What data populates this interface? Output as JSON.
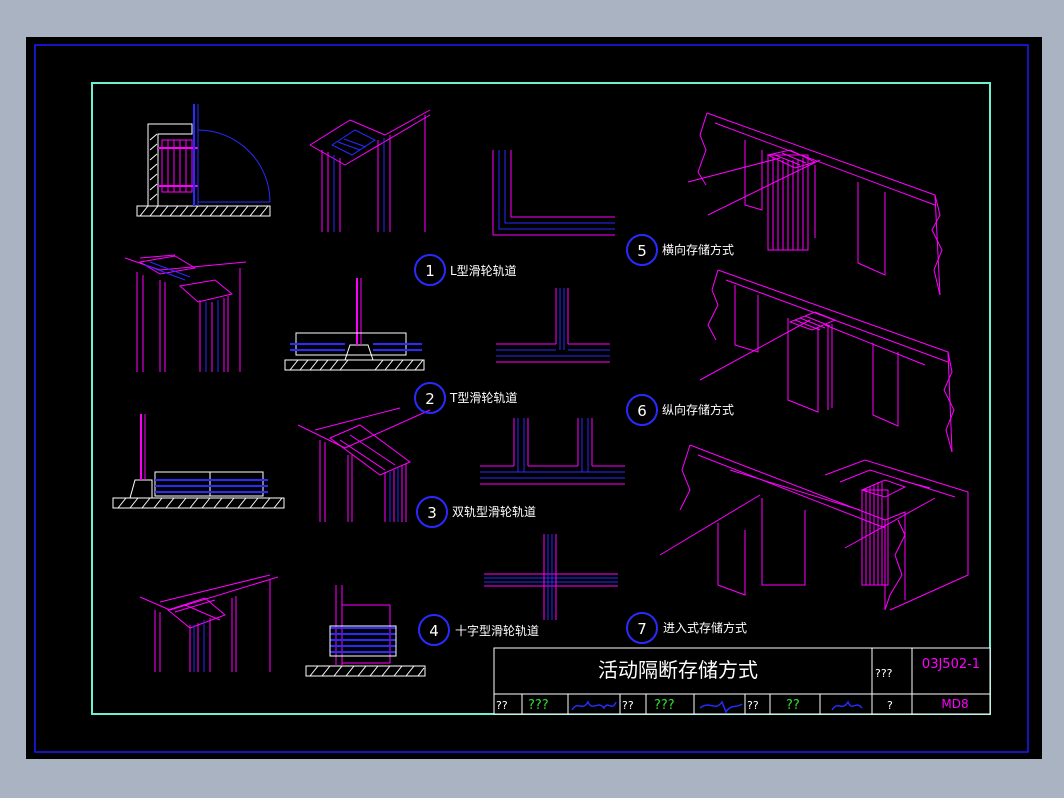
{
  "colors": {
    "background_gray": "#a9b3c1",
    "canvas": "#000000",
    "outer_frame": "#1a1aff",
    "inner_frame": "#6cf0d0",
    "magenta": "#ff00ff",
    "blue": "#2a2aff",
    "white": "#ffffff",
    "green": "#33dd33",
    "cyan": "#00ffff"
  },
  "callouts": [
    {
      "num": "1",
      "label": "L型滑轮轨道"
    },
    {
      "num": "2",
      "label": "T型滑轮轨道"
    },
    {
      "num": "3",
      "label": "双轨型滑轮轨道"
    },
    {
      "num": "4",
      "label": "十字型滑轮轨道"
    },
    {
      "num": "5",
      "label": "横向存储方式"
    },
    {
      "num": "6",
      "label": "纵向存储方式"
    },
    {
      "num": "7",
      "label": "进入式存储方式"
    }
  ],
  "title_block": {
    "title": "活动隔断存储方式",
    "code_label": "???",
    "atlas_number": "03J502-1",
    "page_label": "?",
    "page_number": "MD8",
    "row": [
      "??",
      "???",
      "??",
      "???",
      "??",
      "??"
    ]
  }
}
